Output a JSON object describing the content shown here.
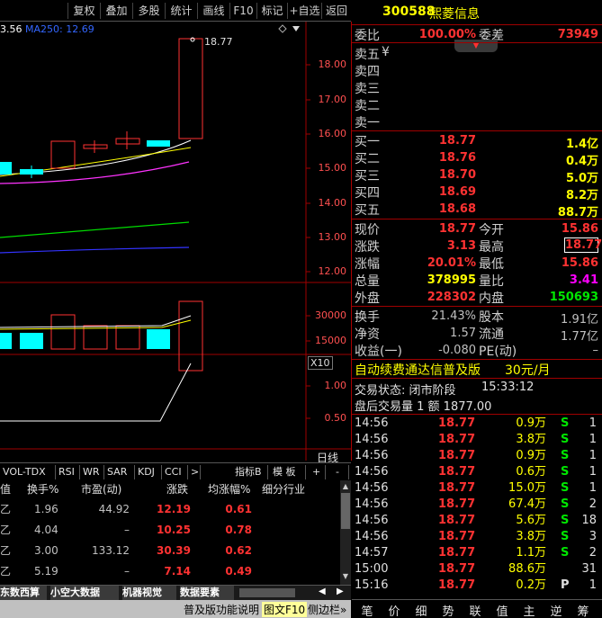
{
  "toolbar": {
    "buttons": [
      "复权",
      "叠加",
      "多股",
      "统计",
      "画线",
      "F10",
      "标记",
      "+自选",
      "返回"
    ]
  },
  "chart": {
    "ma_label_a": "3.56",
    "ma_label_b": "MA250: 12.69",
    "last_price_label": "18.77",
    "y_ticks": [
      "18.00",
      "17.00",
      "16.00",
      "15.00",
      "14.00",
      "13.00",
      "12.00"
    ],
    "vol_ticks": [
      "30000",
      "15000"
    ],
    "vol_unit": "X10",
    "ind_ticks": [
      "1.00",
      "0.50"
    ],
    "period": "日线"
  },
  "indicator_tabs": [
    "VOL-TDX",
    "RSI",
    "WR",
    "SAR",
    "KDJ",
    "CCI",
    ">",
    "指标B",
    "模 板",
    "+",
    "-"
  ],
  "table": {
    "headers": [
      "值",
      "换手%",
      "市盈(动)",
      "涨跌",
      "均涨幅%",
      "细分行业"
    ],
    "rows": [
      {
        "a": "乙",
        "turnover": "1.96",
        "pe": "44.92",
        "change": "12.19",
        "avg": "0.61"
      },
      {
        "a": "乙",
        "turnover": "4.04",
        "pe": "–",
        "change": "10.25",
        "avg": "0.78"
      },
      {
        "a": "乙",
        "turnover": "3.00",
        "pe": "133.12",
        "change": "30.39",
        "avg": "0.62"
      },
      {
        "a": "乙",
        "turnover": "5.19",
        "pe": "–",
        "change": "7.14",
        "avg": "0.49"
      }
    ]
  },
  "bottom_tabs": [
    "东数西算",
    "小空大数据",
    "机器视觉",
    "数据要素"
  ],
  "status_strip": {
    "left": "普及版功能说明",
    "mid": "图文F10",
    "right": "侧边栏»"
  },
  "stock": {
    "code": "300588",
    "name": "熙菱信息"
  },
  "order_ratio": {
    "label1": "委比",
    "value1": "100.00%",
    "label2": "委差",
    "value2": "73949"
  },
  "asks": [
    {
      "label": "卖五",
      "extra": "¥"
    },
    {
      "label": "卖四"
    },
    {
      "label": "卖三"
    },
    {
      "label": "卖二"
    },
    {
      "label": "卖一"
    }
  ],
  "bids": [
    {
      "label": "买一",
      "price": "18.77",
      "vol": "1.4亿"
    },
    {
      "label": "买二",
      "price": "18.76",
      "vol": "0.4万"
    },
    {
      "label": "买三",
      "price": "18.70",
      "vol": "5.0万"
    },
    {
      "label": "买四",
      "price": "18.69",
      "vol": "8.2万"
    },
    {
      "label": "买五",
      "price": "18.68",
      "vol": "88.7万"
    }
  ],
  "quote": {
    "price_lbl": "现价",
    "price": "18.77",
    "open_lbl": "今开",
    "open": "15.86",
    "chg_lbl": "涨跌",
    "chg": "3.13",
    "high_lbl": "最高",
    "high": "18.77",
    "pct_lbl": "涨幅",
    "pct": "20.01%",
    "low_lbl": "最低",
    "low": "15.86",
    "vol_lbl": "总量",
    "vol": "378995",
    "vr_lbl": "量比",
    "vr": "3.41",
    "out_lbl": "外盘",
    "out": "228302",
    "in_lbl": "内盘",
    "in": "150693",
    "turn_lbl": "换手",
    "turn": "21.43%",
    "cap_lbl": "股本",
    "cap": "1.91亿",
    "nav_lbl": "净资",
    "nav": "1.57",
    "float_lbl": "流通",
    "float": "1.77亿",
    "eps_lbl": "收益(一)",
    "eps": "-0.080",
    "pe_lbl": "PE(动)",
    "pe": "–"
  },
  "promo": {
    "text": "自动续费通达信普及版",
    "price": "30元/月"
  },
  "trade_status": {
    "label": "交易状态: 闭市阶段",
    "time": "15:33:12",
    "after": "盘后交易量 1 额 1877.00"
  },
  "ticks": [
    {
      "time": "14:56",
      "price": "18.77",
      "vol": "0.9万",
      "side": "S",
      "n": "1"
    },
    {
      "time": "14:56",
      "price": "18.77",
      "vol": "3.8万",
      "side": "S",
      "n": "1"
    },
    {
      "time": "14:56",
      "price": "18.77",
      "vol": "0.9万",
      "side": "S",
      "n": "1"
    },
    {
      "time": "14:56",
      "price": "18.77",
      "vol": "0.6万",
      "side": "S",
      "n": "1"
    },
    {
      "time": "14:56",
      "price": "18.77",
      "vol": "15.0万",
      "side": "S",
      "n": "1"
    },
    {
      "time": "14:56",
      "price": "18.77",
      "vol": "67.4万",
      "side": "S",
      "n": "2"
    },
    {
      "time": "14:56",
      "price": "18.77",
      "vol": "5.6万",
      "side": "S",
      "n": "18"
    },
    {
      "time": "14:56",
      "price": "18.77",
      "vol": "3.8万",
      "side": "S",
      "n": "3"
    },
    {
      "time": "14:57",
      "price": "18.77",
      "vol": "1.1万",
      "side": "S",
      "n": "2"
    },
    {
      "time": "15:00",
      "price": "18.77",
      "vol": "88.6万",
      "side": "",
      "n": "31"
    },
    {
      "time": "15:16",
      "price": "18.77",
      "vol": "0.2万",
      "side": "P",
      "n": "1"
    }
  ],
  "right_bottom_tabs": [
    "笔",
    "价",
    "细",
    "势",
    "联",
    "值",
    "主",
    "逆",
    "筹"
  ]
}
